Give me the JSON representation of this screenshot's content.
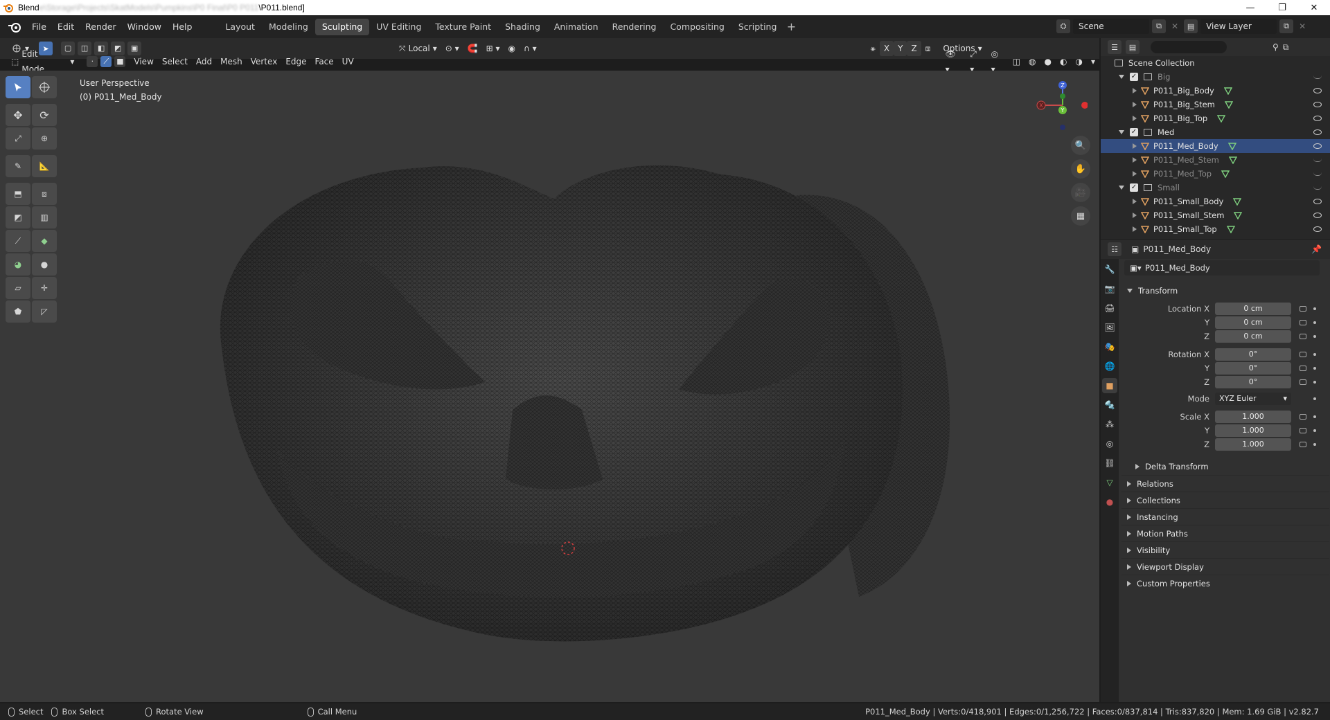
{
  "os_title": {
    "prefix": "Blend",
    "blurred": "e\\Storage\\Projects\\SkatModels\\Pumpkins\\P0 Final\\P0 P011",
    "suffix": "\\P011.blend]"
  },
  "top_menu": [
    "File",
    "Edit",
    "Render",
    "Window",
    "Help"
  ],
  "workspaces": [
    "Layout",
    "Modeling",
    "Sculpting",
    "UV Editing",
    "Texture Paint",
    "Shading",
    "Animation",
    "Rendering",
    "Compositing",
    "Scripting"
  ],
  "active_workspace": "Sculpting",
  "scene_name": "Scene",
  "view_layer": "View Layer",
  "viewport_header": {
    "transform_orientation": "Local",
    "axes": [
      "X",
      "Y",
      "Z"
    ],
    "options_label": "Options",
    "mode": "Edit Mode",
    "menus": [
      "View",
      "Select",
      "Add",
      "Mesh",
      "Vertex",
      "Edge",
      "Face",
      "UV"
    ]
  },
  "viewport_info": {
    "perspective": "User Perspective",
    "object": "(0) P011_Med_Body"
  },
  "outliner": {
    "root": "Scene Collection",
    "rows": [
      {
        "label": "Big",
        "type": "collection",
        "indent": 1,
        "dim": true,
        "eye": "closed"
      },
      {
        "label": "P011_Big_Body",
        "type": "mesh",
        "indent": 2,
        "eye": "open"
      },
      {
        "label": "P011_Big_Stem",
        "type": "mesh",
        "indent": 2,
        "eye": "open"
      },
      {
        "label": "P011_Big_Top",
        "type": "mesh",
        "indent": 2,
        "eye": "open"
      },
      {
        "label": "Med",
        "type": "collection",
        "indent": 1,
        "eye": "open"
      },
      {
        "label": "P011_Med_Body",
        "type": "mesh",
        "indent": 2,
        "eye": "open",
        "selected": true
      },
      {
        "label": "P011_Med_Stem",
        "type": "mesh",
        "indent": 2,
        "dim": true,
        "eye": "closed"
      },
      {
        "label": "P011_Med_Top",
        "type": "mesh",
        "indent": 2,
        "dim": true,
        "eye": "closed"
      },
      {
        "label": "Small",
        "type": "collection",
        "indent": 1,
        "dim": true,
        "eye": "closed"
      },
      {
        "label": "P011_Small_Body",
        "type": "mesh",
        "indent": 2,
        "eye": "open"
      },
      {
        "label": "P011_Small_Stem",
        "type": "mesh",
        "indent": 2,
        "eye": "open"
      },
      {
        "label": "P011_Small_Top",
        "type": "mesh",
        "indent": 2,
        "eye": "open"
      }
    ]
  },
  "properties": {
    "header_object": "P011_Med_Body",
    "object_name": "P011_Med_Body",
    "transform_title": "Transform",
    "location": {
      "label_x": "Location X",
      "x": "0 cm",
      "y": "0 cm",
      "z": "0 cm"
    },
    "rotation": {
      "label_x": "Rotation X",
      "x": "0°",
      "y": "0°",
      "z": "0°"
    },
    "mode_label": "Mode",
    "mode_value": "XYZ Euler",
    "scale": {
      "label_x": "Scale X",
      "x": "1.000",
      "y": "1.000",
      "z": "1.000"
    },
    "axis_y": "Y",
    "axis_z": "Z",
    "delta_transform": "Delta Transform",
    "panels": [
      "Relations",
      "Collections",
      "Instancing",
      "Motion Paths",
      "Visibility",
      "Viewport Display",
      "Custom Properties"
    ]
  },
  "statusbar": {
    "select": "Select",
    "box_select": "Box Select",
    "rotate_view": "Rotate View",
    "call_menu": "Call Menu",
    "stats": "P011_Med_Body | Verts:0/418,901 | Edges:0/1,256,722 | Faces:0/837,814 | Tris:837,820 | Mem: 1.69 GiB | v2.82.7"
  },
  "colors": {
    "accent": "#4772b3",
    "selected_row": "#334d80",
    "mesh_icon": "#e0a060",
    "data_icon": "#7fd07f"
  }
}
